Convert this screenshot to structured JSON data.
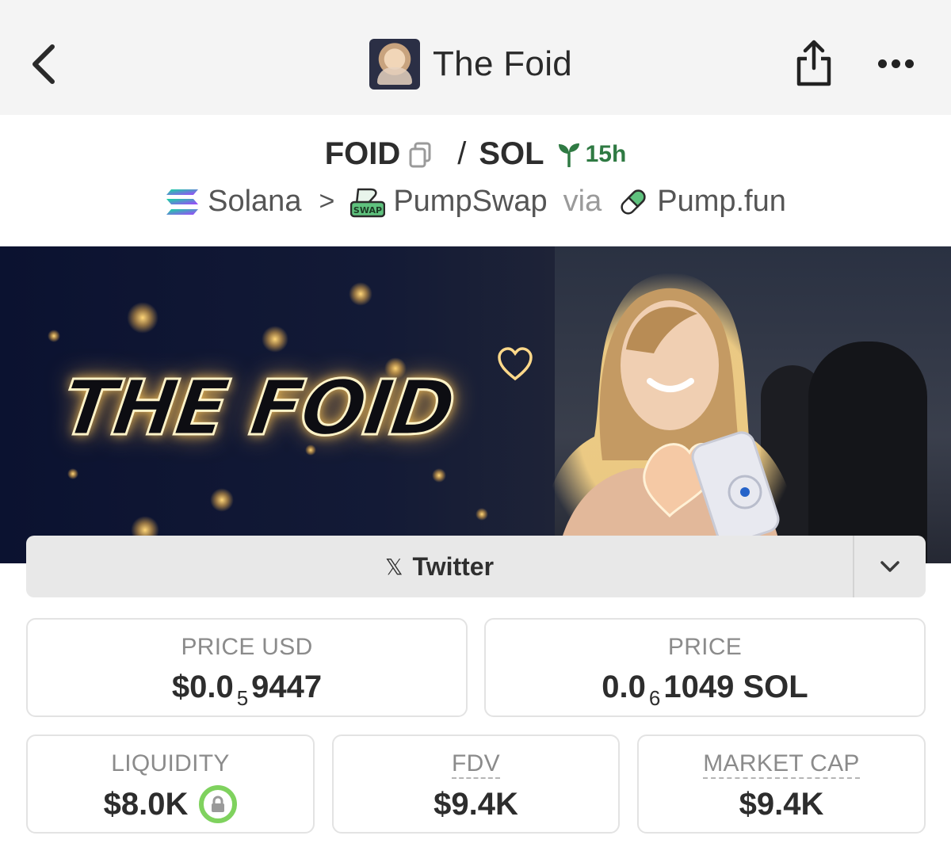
{
  "header": {
    "title": "The Foid"
  },
  "pair": {
    "base": "FOID",
    "slash": "/",
    "quote": "SOL",
    "age": "15h"
  },
  "route": {
    "chain": "Solana",
    "separator": ">",
    "dex": "PumpSwap",
    "via": "via",
    "launchpad": "Pump.fun",
    "dex_badge": "SWAP"
  },
  "banner": {
    "headline": "THE FOID"
  },
  "socials": {
    "x_glyph": "𝕏",
    "label": "Twitter"
  },
  "stats": {
    "price_usd": {
      "label": "PRICE USD",
      "prefix": "$0.0",
      "zeros": "5",
      "digits": "9447"
    },
    "price": {
      "label": "PRICE",
      "prefix": "0.0",
      "zeros": "6",
      "digits": "1049 SOL"
    },
    "liquidity": {
      "label": "LIQUIDITY",
      "value": "$8.0K"
    },
    "fdv": {
      "label": "FDV",
      "value": "$9.4K"
    },
    "market_cap": {
      "label": "MARKET CAP",
      "value": "$9.4K"
    }
  },
  "colors": {
    "accent_green": "#2f7a43",
    "lock_ring": "#7fd25e",
    "topbar_bg": "#f4f4f4"
  },
  "icons": [
    "back-chevron-icon",
    "share-icon",
    "more-icon",
    "copy-icon",
    "sprout-icon",
    "solana-icon",
    "pumpswap-icon",
    "pill-icon",
    "x-logo-icon",
    "chevron-down-icon",
    "lock-icon",
    "heart-icon"
  ]
}
